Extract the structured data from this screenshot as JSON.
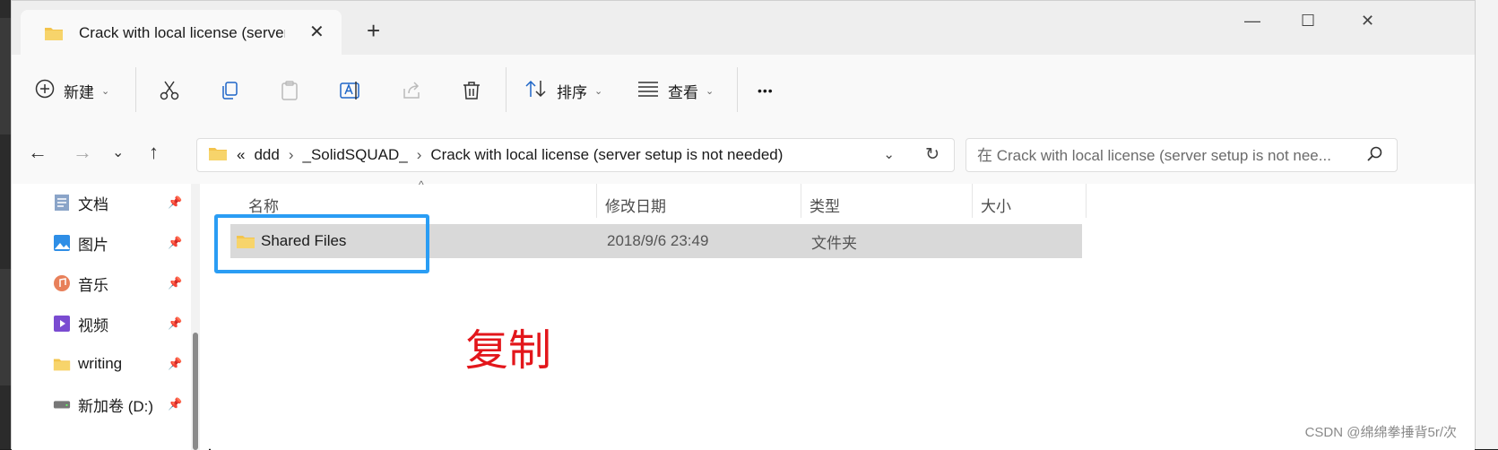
{
  "window": {
    "tab_title": "Crack with local license (server setup is not needed)",
    "new_tab": "+",
    "close_tab": "✕",
    "controls": {
      "minimize": "—",
      "maximize": "☐",
      "close": "✕"
    }
  },
  "toolbar": {
    "new_label": "新建",
    "sort_label": "排序",
    "view_label": "查看",
    "more_label": "•••",
    "caret": "⌄"
  },
  "address": {
    "overflow": "«",
    "crumbs": [
      "ddd",
      "_SolidSQUAD_",
      "Crack with local license (server setup is not needed)"
    ],
    "separator": "›",
    "search_placeholder": "在 Crack with local license (server setup is not nee..."
  },
  "nav": {
    "items": [
      {
        "label": "文档",
        "icon": "document-icon"
      },
      {
        "label": "图片",
        "icon": "pictures-icon"
      },
      {
        "label": "音乐",
        "icon": "music-icon"
      },
      {
        "label": "视频",
        "icon": "video-icon"
      },
      {
        "label": "writing",
        "icon": "folder-icon"
      },
      {
        "label": "新加卷 (D:)",
        "icon": "drive-icon"
      }
    ]
  },
  "columns": {
    "name": "名称",
    "modified": "修改日期",
    "type": "类型",
    "size": "大小"
  },
  "files": [
    {
      "name": "Shared Files",
      "modified": "2018/9/6 23:49",
      "type": "文件夹",
      "size": ""
    }
  ],
  "annotation": "复制",
  "watermark": "CSDN @绵绵拳捶背5r/次",
  "colors": {
    "accent": "#2a9df4",
    "annotation": "#e3161b",
    "folder": "#f3c44d"
  }
}
